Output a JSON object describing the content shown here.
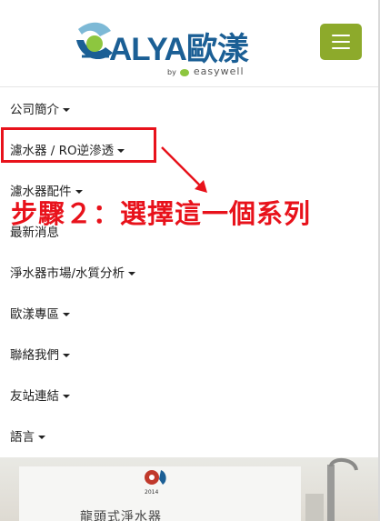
{
  "header": {
    "logo_text": "ALYA歐漾",
    "logo_by": "by",
    "logo_brand": "easywell",
    "menu_button_label": "Toggle navigation"
  },
  "nav": {
    "items": [
      {
        "label": "公司簡介"
      },
      {
        "label": "濾水器 / RO逆滲透"
      },
      {
        "label": "濾水器配件"
      },
      {
        "label": "最新消息"
      },
      {
        "label": "淨水器市場/水質分析"
      },
      {
        "label": "歐漾專區"
      },
      {
        "label": "聯絡我們"
      },
      {
        "label": "友站連結"
      },
      {
        "label": "語言"
      }
    ]
  },
  "annotation": {
    "text": "步驟２：選擇這一個系列",
    "color": "#e8121b"
  },
  "banner": {
    "title": "龍頭式淨水器",
    "cert_year": "2014"
  },
  "colors": {
    "brand_blue": "#1b5f95",
    "menu_button": "#8daa2b"
  }
}
